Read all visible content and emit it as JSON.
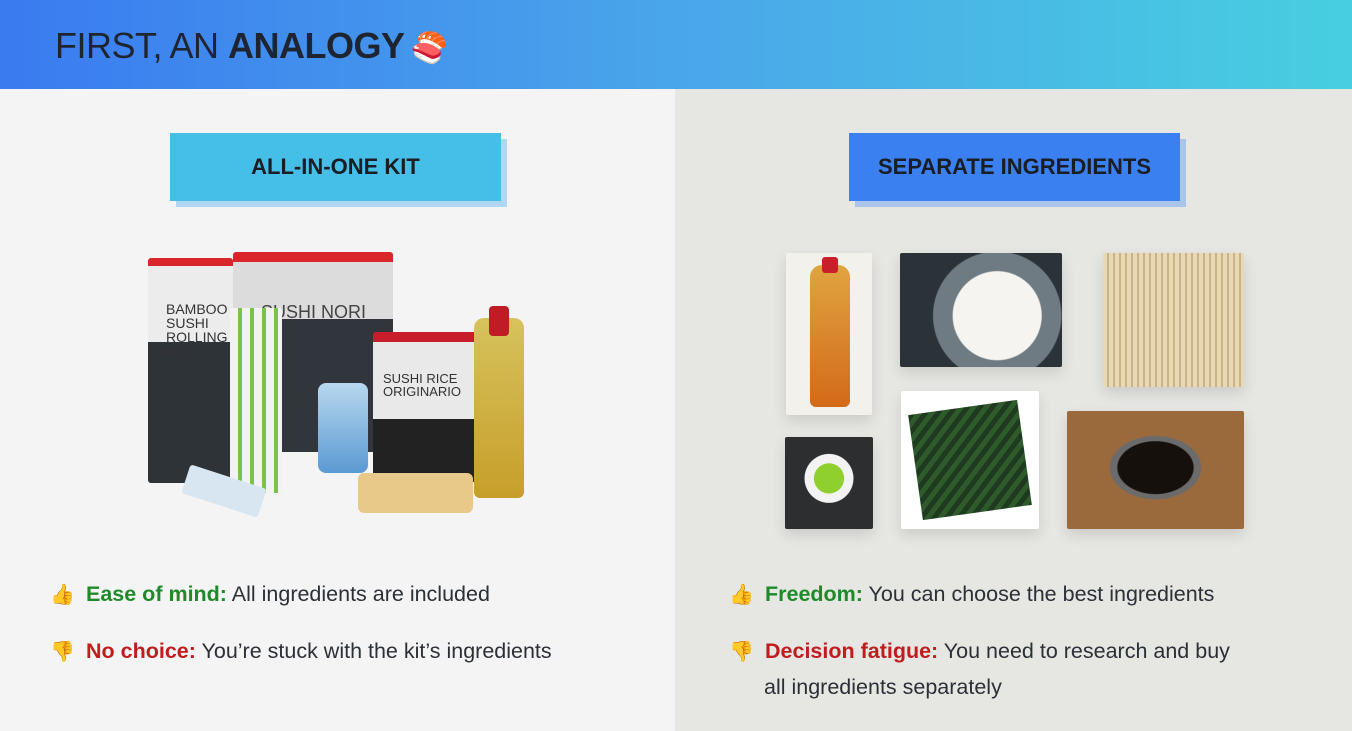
{
  "header": {
    "title_plain": "FIRST, AN ",
    "title_bold": "ANALOGY",
    "title_emoji": "🍣"
  },
  "left": {
    "tag": "ALL-IN-ONE KIT",
    "kit_labels": {
      "bamboo": "BAMBOO SUSHI ROLLING MAT",
      "nori": "SUSHI NORI",
      "rice": "SUSHI RICE ORIGINARIO"
    },
    "pro": {
      "icon": "👍",
      "label": "Ease of mind:",
      "text": " All ingredients are included"
    },
    "con": {
      "icon": "👎",
      "label": "No choice:",
      "text": " You’re stuck with the kit’s ingredients"
    }
  },
  "right": {
    "tag": "SEPARATE INGREDIENTS",
    "pro": {
      "icon": "👍",
      "label": "Freedom:",
      "text": " You can choose the best ingredients"
    },
    "con": {
      "icon": "👎",
      "label": "Decision fatigue:",
      "text": " You need to research and buy",
      "text2": "all ingredients separately"
    }
  },
  "colors": {
    "pro": "#1f8a2a",
    "con": "#c01e1e",
    "tag_left": "#45bfe8",
    "tag_right": "#3b80f0"
  }
}
